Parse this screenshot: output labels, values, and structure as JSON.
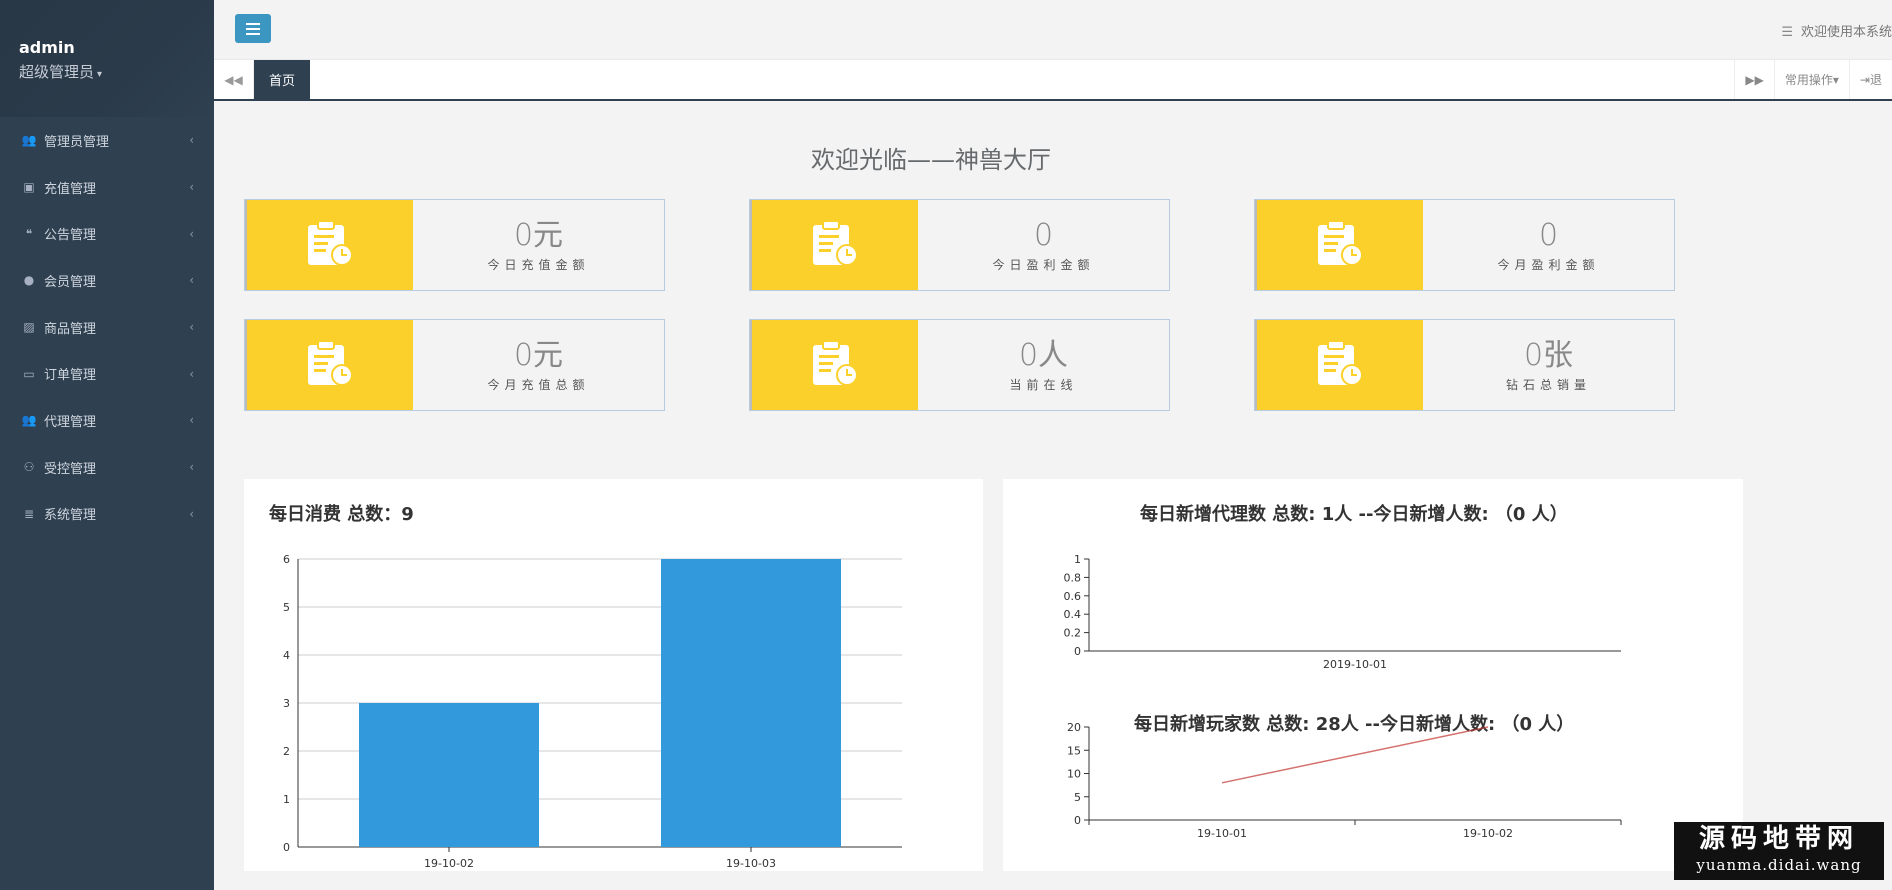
{
  "sidebar": {
    "username": "admin",
    "role": "超级管理员",
    "items": [
      {
        "label": "管理员管理",
        "icon": "users-icon"
      },
      {
        "label": "充值管理",
        "icon": "money-icon"
      },
      {
        "label": "公告管理",
        "icon": "comments-icon"
      },
      {
        "label": "会员管理",
        "icon": "user-icon"
      },
      {
        "label": "商品管理",
        "icon": "image-icon"
      },
      {
        "label": "订单管理",
        "icon": "card-icon"
      },
      {
        "label": "代理管理",
        "icon": "users-icon"
      },
      {
        "label": "受控管理",
        "icon": "motorcycle-icon"
      },
      {
        "label": "系统管理",
        "icon": "server-icon"
      }
    ]
  },
  "topbar": {
    "welcome": "欢迎使用本系统"
  },
  "tabs": {
    "home": "首页",
    "common_ops": "常用操作",
    "logout": "退"
  },
  "main": {
    "title": "欢迎光临——神兽大厅"
  },
  "stats": [
    {
      "value": "0元",
      "label": "今日充值金额"
    },
    {
      "value": "0",
      "label": "今日盈利金额"
    },
    {
      "value": "0",
      "label": "今月盈利金额"
    },
    {
      "value": "0元",
      "label": "今月充值总额"
    },
    {
      "value": "0人",
      "label": "当前在线"
    },
    {
      "value": "0张",
      "label": "钻石总销量"
    }
  ],
  "colors": {
    "sidebar": "#2f4050",
    "accent_yellow": "#fbd02a",
    "bar": "#3399dd",
    "line": "#c23531"
  },
  "chart_data": [
    {
      "type": "bar",
      "title": "每日消费 总数：9",
      "categories": [
        "19-10-02",
        "19-10-03"
      ],
      "values": [
        3,
        6
      ],
      "ylim": [
        0,
        6
      ],
      "yticks": [
        0,
        1,
        2,
        3,
        4,
        5,
        6
      ],
      "grid": true
    },
    {
      "type": "line",
      "title": "每日新增代理数  总数: 1人 --今日新增人数:  （0 人）",
      "categories": [
        "2019-10-01"
      ],
      "values": [],
      "ylim": [
        0,
        1
      ],
      "yticks": [
        "0",
        "0.2",
        "0.4",
        "0.6",
        "0.8",
        "1"
      ]
    },
    {
      "type": "line",
      "title": "每日新增玩家数  总数: 28人 --今日新增人数:  （0 人）",
      "categories": [
        "19-10-01",
        "19-10-02"
      ],
      "values": [
        8,
        20
      ],
      "ylim": [
        0,
        20
      ],
      "yticks": [
        0,
        5,
        10,
        15,
        20
      ]
    }
  ],
  "watermark": {
    "line1": "源码地带网",
    "line2": "yuanma.didai.wang"
  }
}
